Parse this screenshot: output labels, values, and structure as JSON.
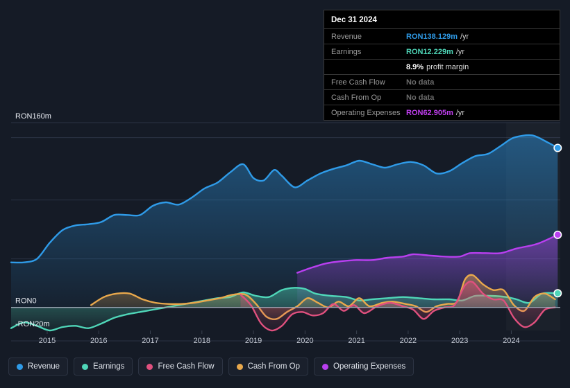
{
  "tooltip": {
    "date": "Dec 31 2024",
    "rows": [
      {
        "label": "Revenue",
        "value": "RON138.129m",
        "unit": "/yr",
        "color": "#2f9be8",
        "nodata": false
      },
      {
        "label": "Earnings",
        "value": "RON12.229m",
        "unit": "/yr",
        "color": "#4fd6b8",
        "nodata": false
      },
      {
        "label": "",
        "value": "8.9%",
        "unit": "profit margin",
        "color": "#ffffff",
        "nodata": false
      },
      {
        "label": "Free Cash Flow",
        "value": "No data",
        "unit": "",
        "color": "#6d6d6d",
        "nodata": true
      },
      {
        "label": "Cash From Op",
        "value": "No data",
        "unit": "",
        "color": "#6d6d6d",
        "nodata": true
      },
      {
        "label": "Operating Expenses",
        "value": "RON62.905m",
        "unit": "/yr",
        "color": "#c13ff0",
        "nodata": false
      }
    ]
  },
  "legend": {
    "items": [
      {
        "label": "Revenue",
        "color": "#2f9be8"
      },
      {
        "label": "Earnings",
        "color": "#4fd6b8"
      },
      {
        "label": "Free Cash Flow",
        "color": "#e0507e"
      },
      {
        "label": "Cash From Op",
        "color": "#e8a84c"
      },
      {
        "label": "Operating Expenses",
        "color": "#b93ff0"
      }
    ]
  },
  "chart_data": {
    "type": "area",
    "title": "",
    "xlabel": "",
    "ylabel": "RON",
    "currency": "RON",
    "ylim": [
      -20,
      160
    ],
    "yticks": [
      {
        "value": 160,
        "label": "RON160m"
      },
      {
        "value": 0,
        "label": "RON0"
      },
      {
        "value": -20,
        "label": "-RON20m"
      }
    ],
    "gridlines": [
      160,
      147,
      93,
      42,
      0,
      -29
    ],
    "zero_line": 0,
    "x": [
      2014.3,
      2015,
      2016,
      2017,
      2018,
      2019,
      2020,
      2021,
      2022,
      2023,
      2024,
      2024.9
    ],
    "xticks": [
      "2015",
      "2016",
      "2017",
      "2018",
      "2019",
      "2020",
      "2021",
      "2022",
      "2023",
      "2024"
    ],
    "forecast_band_start": 2023.9,
    "series": [
      {
        "name": "Revenue",
        "color": "#2f9be8",
        "fill": true,
        "points": [
          [
            2014.3,
            39
          ],
          [
            2014.55,
            39
          ],
          [
            2014.8,
            42
          ],
          [
            2015.05,
            56
          ],
          [
            2015.3,
            67
          ],
          [
            2015.55,
            71
          ],
          [
            2015.8,
            72
          ],
          [
            2016.05,
            74
          ],
          [
            2016.3,
            80
          ],
          [
            2016.55,
            80
          ],
          [
            2016.8,
            80
          ],
          [
            2017.05,
            88
          ],
          [
            2017.3,
            91
          ],
          [
            2017.55,
            89
          ],
          [
            2017.8,
            95
          ],
          [
            2018.05,
            103
          ],
          [
            2018.3,
            108
          ],
          [
            2018.55,
            117
          ],
          [
            2018.8,
            124
          ],
          [
            2019.0,
            112
          ],
          [
            2019.2,
            110
          ],
          [
            2019.4,
            119
          ],
          [
            2019.55,
            114
          ],
          [
            2019.8,
            104
          ],
          [
            2020.05,
            110
          ],
          [
            2020.3,
            116
          ],
          [
            2020.55,
            120
          ],
          [
            2020.8,
            123
          ],
          [
            2021.05,
            127
          ],
          [
            2021.3,
            124
          ],
          [
            2021.55,
            121
          ],
          [
            2021.8,
            124
          ],
          [
            2022.05,
            126
          ],
          [
            2022.3,
            123
          ],
          [
            2022.55,
            116
          ],
          [
            2022.8,
            118
          ],
          [
            2023.05,
            125
          ],
          [
            2023.3,
            131
          ],
          [
            2023.55,
            133
          ],
          [
            2023.8,
            140
          ],
          [
            2024.05,
            147
          ],
          [
            2024.4,
            149
          ],
          [
            2024.7,
            143
          ],
          [
            2024.9,
            138.129
          ]
        ]
      },
      {
        "name": "Operating Expenses",
        "color": "#b93ff0",
        "fill": true,
        "start_x": 2019.85,
        "points": [
          [
            2019.85,
            30
          ],
          [
            2020.1,
            34
          ],
          [
            2020.4,
            38
          ],
          [
            2020.7,
            40
          ],
          [
            2021.0,
            41
          ],
          [
            2021.3,
            41
          ],
          [
            2021.6,
            43
          ],
          [
            2021.9,
            44
          ],
          [
            2022.1,
            46
          ],
          [
            2022.4,
            45
          ],
          [
            2022.7,
            44
          ],
          [
            2023.0,
            44
          ],
          [
            2023.2,
            47
          ],
          [
            2023.5,
            47
          ],
          [
            2023.8,
            47
          ],
          [
            2024.1,
            51
          ],
          [
            2024.5,
            55
          ],
          [
            2024.9,
            62.905
          ]
        ]
      },
      {
        "name": "Earnings",
        "color": "#4fd6b8",
        "fill": true,
        "points": [
          [
            2014.3,
            -18
          ],
          [
            2014.55,
            -13
          ],
          [
            2014.8,
            -16
          ],
          [
            2015.05,
            -20
          ],
          [
            2015.3,
            -17
          ],
          [
            2015.55,
            -16
          ],
          [
            2015.8,
            -18
          ],
          [
            2016.05,
            -14
          ],
          [
            2016.3,
            -9
          ],
          [
            2016.55,
            -6
          ],
          [
            2016.8,
            -4
          ],
          [
            2017.05,
            -2
          ],
          [
            2017.3,
            0
          ],
          [
            2017.55,
            2
          ],
          [
            2017.8,
            4
          ],
          [
            2018.05,
            6
          ],
          [
            2018.3,
            8
          ],
          [
            2018.55,
            9
          ],
          [
            2018.8,
            13
          ],
          [
            2019.05,
            10
          ],
          [
            2019.3,
            9
          ],
          [
            2019.55,
            15
          ],
          [
            2019.8,
            17
          ],
          [
            2020.0,
            16
          ],
          [
            2020.2,
            12
          ],
          [
            2020.5,
            10
          ],
          [
            2020.8,
            9
          ],
          [
            2021.05,
            6
          ],
          [
            2021.3,
            7
          ],
          [
            2021.6,
            8
          ],
          [
            2021.9,
            9
          ],
          [
            2022.2,
            8
          ],
          [
            2022.5,
            7
          ],
          [
            2022.8,
            7
          ],
          [
            2023.05,
            6
          ],
          [
            2023.3,
            10
          ],
          [
            2023.6,
            10
          ],
          [
            2023.9,
            9
          ],
          [
            2024.1,
            7
          ],
          [
            2024.35,
            4
          ],
          [
            2024.6,
            12
          ],
          [
            2024.9,
            12.229
          ]
        ]
      },
      {
        "name": "Cash From Op",
        "color": "#e8a84c",
        "fill": true,
        "start_x": 2015.85,
        "points": [
          [
            2015.85,
            2
          ],
          [
            2016.1,
            9
          ],
          [
            2016.35,
            12
          ],
          [
            2016.6,
            12
          ],
          [
            2016.85,
            7
          ],
          [
            2017.1,
            4
          ],
          [
            2017.35,
            3
          ],
          [
            2017.6,
            3
          ],
          [
            2017.85,
            4
          ],
          [
            2018.1,
            6
          ],
          [
            2018.35,
            8
          ],
          [
            2018.6,
            11
          ],
          [
            2018.85,
            11
          ],
          [
            2019.05,
            3
          ],
          [
            2019.25,
            -8
          ],
          [
            2019.45,
            -10
          ],
          [
            2019.65,
            -4
          ],
          [
            2019.85,
            1
          ],
          [
            2020.05,
            8
          ],
          [
            2020.25,
            4
          ],
          [
            2020.45,
            0
          ],
          [
            2020.65,
            5
          ],
          [
            2020.85,
            1
          ],
          [
            2021.05,
            8
          ],
          [
            2021.25,
            1
          ],
          [
            2021.5,
            4
          ],
          [
            2021.7,
            5
          ],
          [
            2021.95,
            3
          ],
          [
            2022.15,
            1
          ],
          [
            2022.35,
            -4
          ],
          [
            2022.55,
            1
          ],
          [
            2022.75,
            3
          ],
          [
            2022.95,
            5
          ],
          [
            2023.1,
            24
          ],
          [
            2023.25,
            28
          ],
          [
            2023.45,
            20
          ],
          [
            2023.65,
            15
          ],
          [
            2023.85,
            15
          ],
          [
            2024.05,
            2
          ],
          [
            2024.25,
            -3
          ],
          [
            2024.45,
            9
          ],
          [
            2024.65,
            12
          ],
          [
            2024.85,
            7
          ]
        ]
      },
      {
        "name": "Free Cash Flow",
        "color": "#e0507e",
        "fill": true,
        "start_x": 2018.75,
        "points": [
          [
            2018.75,
            11
          ],
          [
            2018.95,
            2
          ],
          [
            2019.15,
            -14
          ],
          [
            2019.35,
            -20
          ],
          [
            2019.55,
            -16
          ],
          [
            2019.75,
            -6
          ],
          [
            2019.95,
            -4
          ],
          [
            2020.15,
            -7
          ],
          [
            2020.35,
            -5
          ],
          [
            2020.55,
            3
          ],
          [
            2020.75,
            -3
          ],
          [
            2020.95,
            2
          ],
          [
            2021.15,
            -5
          ],
          [
            2021.4,
            1
          ],
          [
            2021.65,
            4
          ],
          [
            2021.9,
            1
          ],
          [
            2022.1,
            -2
          ],
          [
            2022.3,
            -10
          ],
          [
            2022.5,
            -3
          ],
          [
            2022.7,
            0
          ],
          [
            2022.9,
            2
          ],
          [
            2023.1,
            19
          ],
          [
            2023.25,
            22
          ],
          [
            2023.45,
            12
          ],
          [
            2023.65,
            7
          ],
          [
            2023.85,
            6
          ],
          [
            2024.05,
            -9
          ],
          [
            2024.25,
            -17
          ],
          [
            2024.45,
            -13
          ],
          [
            2024.65,
            -2
          ],
          [
            2024.85,
            0
          ]
        ]
      }
    ]
  }
}
